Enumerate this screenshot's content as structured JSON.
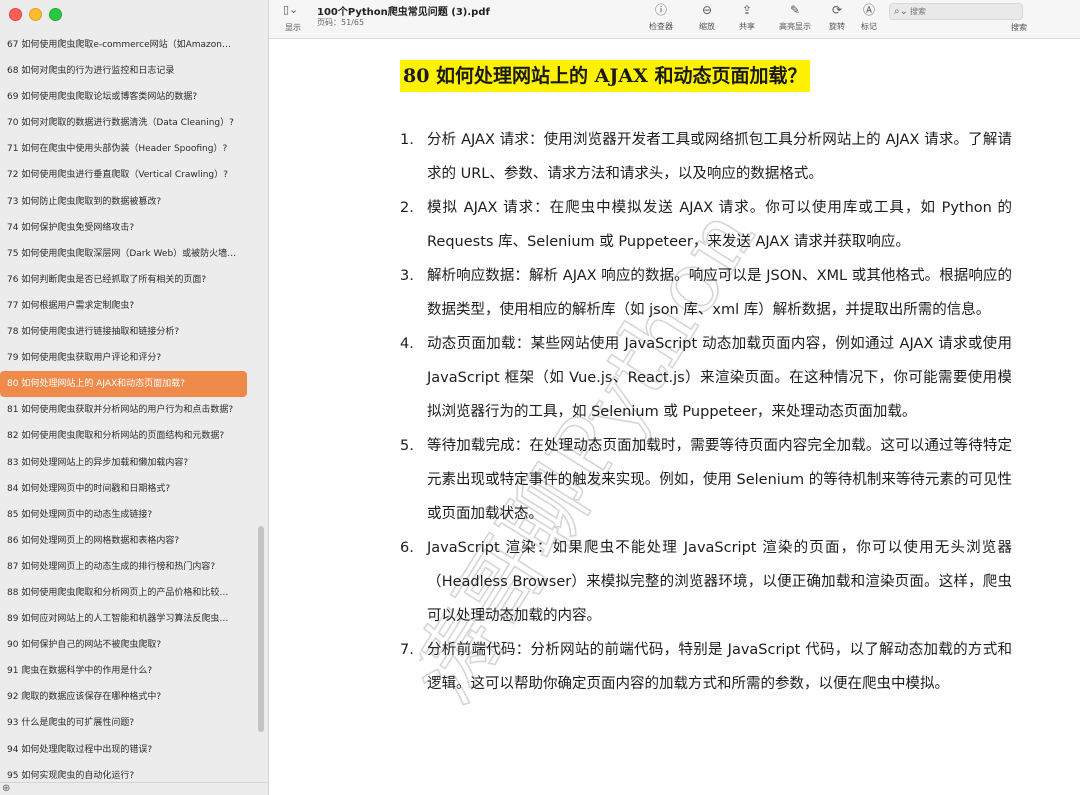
{
  "window": {
    "title": "100个Python爬虫常见问题 (3).pdf",
    "page_indicator": "页码：51/65"
  },
  "toolbar": {
    "sidebar_label": "显示",
    "buttons": [
      {
        "icon": "info-icon",
        "label": "检查器"
      },
      {
        "icon": "zoom-icon",
        "label": "缩放"
      },
      {
        "icon": "share-icon",
        "label": "共享"
      },
      {
        "icon": "highlight-icon",
        "label": "高亮显示"
      },
      {
        "icon": "rotate-icon",
        "label": "旋转"
      },
      {
        "icon": "markup-icon",
        "label": "标记"
      }
    ],
    "search_placeholder": "搜索",
    "search_label": "搜索"
  },
  "sidebar": {
    "active_index": 13,
    "items": [
      "67 如何使用爬虫爬取e-commerce网站（如Amazon…",
      "68 如何对爬虫的行为进行监控和日志记录",
      "69 如何使用爬虫爬取论坛或博客类网站的数据?",
      "70 如何对爬取的数据进行数据清洗（Data Cleaning）?",
      "71 如何在爬虫中使用头部伪装（Header Spoofing）?",
      "72 如何使用爬虫进行垂直爬取（Vertical Crawling）?",
      "73 如何防止爬虫爬取到的数据被篡改?",
      "74 如何保护爬虫免受网络攻击?",
      "75 如何使用爬虫爬取深层网（Dark Web）或被防火墙…",
      "76 如何判断爬虫是否已经抓取了所有相关的页面?",
      "77 如何根据用户需求定制爬虫?",
      "78 如何使用爬虫进行链接抽取和链接分析?",
      "79 如何使用爬虫获取用户评论和评分?",
      "80 如何处理网站上的 AJAX和动态页面加载?",
      "81 如何使用爬虫获取并分析网站的用户行为和点击数据?",
      "82 如何使用爬虫爬取和分析网站的页面结构和元数据?",
      "83 如何处理网站上的异步加载和懒加载内容?",
      "84 如何处理网页中的时间戳和日期格式?",
      "85 如何处理网页中的动态生成链接?",
      "86 如何处理网页上的网格数据和表格内容?",
      "87 如何处理网页上的动态生成的排行榜和热门内容?",
      "88 如何使用爬虫爬取和分析网页上的产品价格和比较…",
      "89 如何应对网站上的人工智能和机器学习算法反爬虫…",
      "90 如何保护自己的网站不被爬虫爬取?",
      "91 爬虫在数据科学中的作用是什么?",
      "92 爬取的数据应该保存在哪种格式中?",
      "93 什么是爬虫的可扩展性问题?",
      "94 如何处理爬取过程中出现的错误?",
      "95 如何实现爬虫的自动化运行?"
    ]
  },
  "document": {
    "heading": "80 如何处理网站上的 AJAX 和动态页面加载？",
    "items": [
      {
        "num": "1.",
        "text": "分析 AJAX 请求：使用浏览器开发者工具或网络抓包工具分析网站上的 AJAX 请求。了解请求的 URL、参数、请求方法和请求头，以及响应的数据格式。"
      },
      {
        "num": "2.",
        "text": "模拟 AJAX 请求：在爬虫中模拟发送 AJAX 请求。你可以使用库或工具，如 Python 的 Requests 库、Selenium 或 Puppeteer，来发送 AJAX 请求并获取响应。"
      },
      {
        "num": "3.",
        "text": "解析响应数据：解析 AJAX 响应的数据。响应可以是 JSON、XML 或其他格式。根据响应的数据类型，使用相应的解析库（如 json 库、xml 库）解析数据，并提取出所需的信息。"
      },
      {
        "num": "4.",
        "text": "动态页面加载：某些网站使用 JavaScript 动态加载页面内容，例如通过 AJAX 请求或使用 JavaScript 框架（如 Vue.js、React.js）来渲染页面。在这种情况下，你可能需要使用模拟浏览器行为的工具，如 Selenium 或 Puppeteer，来处理动态页面加载。"
      },
      {
        "num": "5.",
        "text": "等待加载完成：在处理动态页面加载时，需要等待页面内容完全加载。这可以通过等待特定元素出现或特定事件的触发来实现。例如，使用 Selenium 的等待机制来等待元素的可见性或页面加载状态。"
      },
      {
        "num": "6.",
        "text": "JavaScript 渲染：如果爬虫不能处理 JavaScript 渲染的页面，你可以使用无头浏览器（Headless Browser）来模拟完整的浏览器环境，以便正确加载和渲染页面。这样，爬虫可以处理动态加载的内容。"
      },
      {
        "num": "7.",
        "text": "分析前端代码：分析网站的前端代码，特别是 JavaScript 代码，以了解动态加载的方式和逻辑。这可以帮助你确定页面内容的加载方式和所需的参数，以便在爬虫中模拟。"
      }
    ],
    "watermark_text": "涛哥聊Python"
  }
}
